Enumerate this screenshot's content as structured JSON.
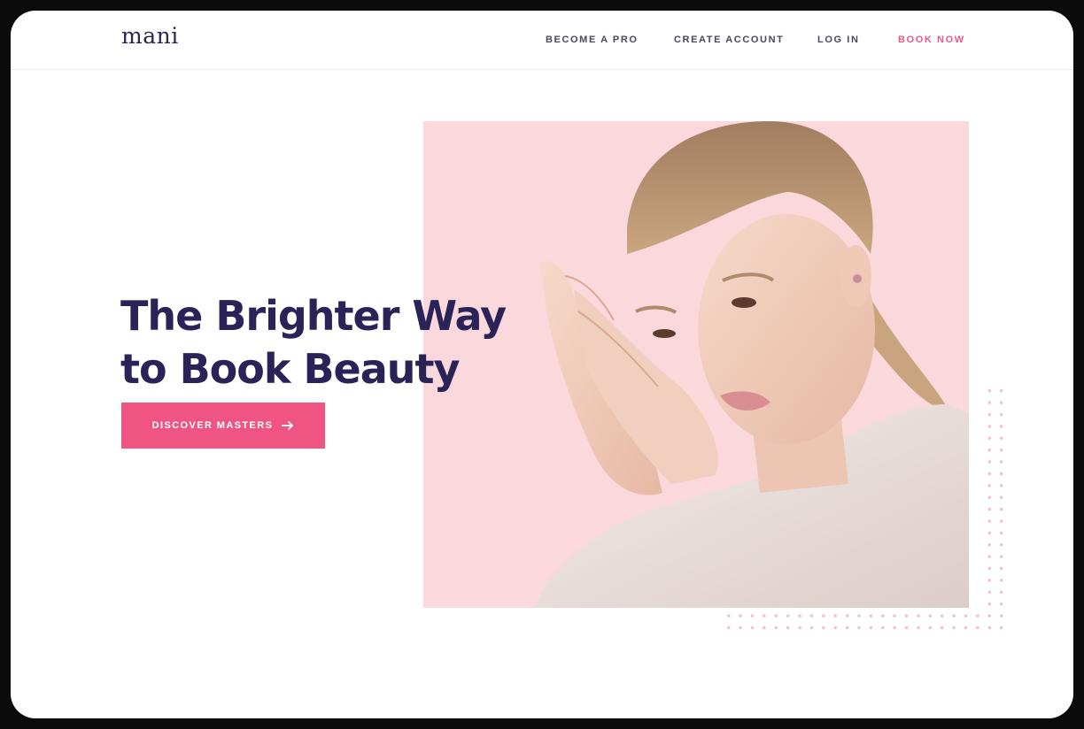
{
  "brand": {
    "logo_text": "mani"
  },
  "nav": {
    "become_pro": "BECOME A PRO",
    "create_account": "CREATE ACCOUNT",
    "log_in": "LOG IN",
    "book_now": "BOOK NOW"
  },
  "hero": {
    "headline_line1": "The Brighter Way",
    "headline_line2": "to Book Beauty",
    "cta_label": "DISCOVER MASTERS",
    "cta_icon": "arrow-right-icon",
    "image_subject": "woman-portrait-image"
  },
  "colors": {
    "accent": "#ef5483",
    "heading": "#2a2357",
    "hero_background": "#fad8dc",
    "dots": "#f4c0cf"
  }
}
